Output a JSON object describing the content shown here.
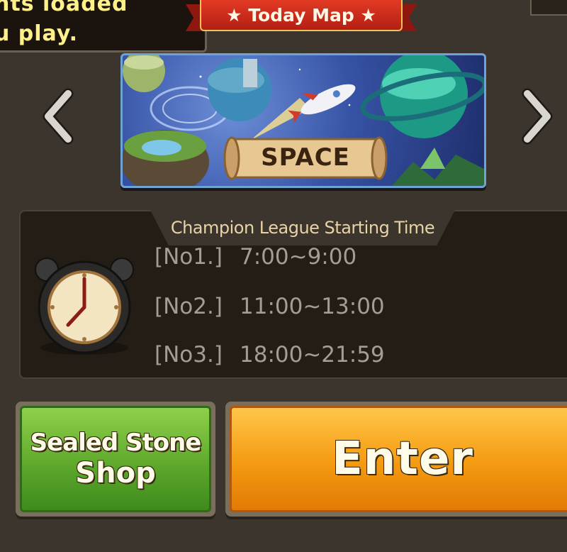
{
  "notice": {
    "line1": "nts loaded",
    "line2": "u play."
  },
  "banner": {
    "title": "★ Today Map ★"
  },
  "map": {
    "name": "SPACE"
  },
  "schedule": {
    "title": "Champion League Starting Time",
    "rows": [
      {
        "no": "[No1.]",
        "time": "7:00~9:00"
      },
      {
        "no": "[No2.]",
        "time": "11:00~13:00"
      },
      {
        "no": "[No3.]",
        "time": "18:00~21:59"
      }
    ]
  },
  "buttons": {
    "sealed_line1": "Sealed Stone",
    "sealed_line2": "Shop",
    "enter": "Enter"
  },
  "icons": {
    "prev": "chevron-left-icon",
    "next": "chevron-right-icon",
    "clock": "alarm-clock-icon"
  },
  "colors": {
    "background": "#3b352d",
    "ribbon": "#c8281a",
    "notice_text": "#fff08a",
    "green_button": "#5aa62a",
    "orange_button": "#f49a10",
    "time_text": "#a49d93"
  }
}
